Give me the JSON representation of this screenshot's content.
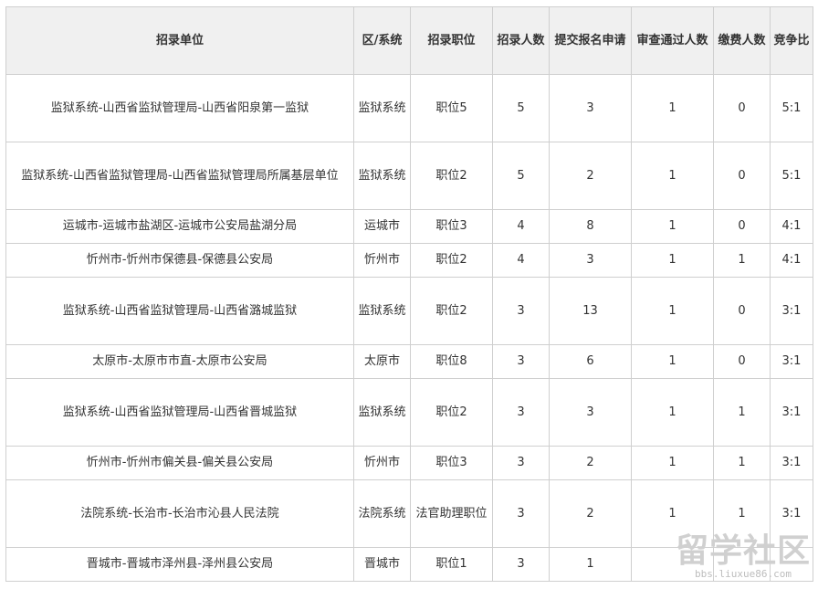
{
  "headers": [
    "招录单位",
    "区/系统",
    "招录职位",
    "招录人数",
    "提交报名申请",
    "审查通过人数",
    "缴费人数",
    "竞争比"
  ],
  "rows": [
    {
      "unit": "监狱系统-山西省监狱管理局-山西省阳泉第一监狱",
      "region": "监狱系统",
      "position": "职位5",
      "quota": "5",
      "submitted": "3",
      "approved": "1",
      "paid": "0",
      "ratio": "5:1"
    },
    {
      "unit": "监狱系统-山西省监狱管理局-山西省监狱管理局所属基层单位",
      "region": "监狱系统",
      "position": "职位2",
      "quota": "5",
      "submitted": "2",
      "approved": "1",
      "paid": "0",
      "ratio": "5:1"
    },
    {
      "unit": "运城市-运城市盐湖区-运城市公安局盐湖分局",
      "region": "运城市",
      "position": "职位3",
      "quota": "4",
      "submitted": "8",
      "approved": "1",
      "paid": "0",
      "ratio": "4:1"
    },
    {
      "unit": "忻州市-忻州市保德县-保德县公安局",
      "region": "忻州市",
      "position": "职位2",
      "quota": "4",
      "submitted": "3",
      "approved": "1",
      "paid": "1",
      "ratio": "4:1"
    },
    {
      "unit": "监狱系统-山西省监狱管理局-山西省潞城监狱",
      "region": "监狱系统",
      "position": "职位2",
      "quota": "3",
      "submitted": "13",
      "approved": "1",
      "paid": "0",
      "ratio": "3:1"
    },
    {
      "unit": "太原市-太原市市直-太原市公安局",
      "region": "太原市",
      "position": "职位8",
      "quota": "3",
      "submitted": "6",
      "approved": "1",
      "paid": "0",
      "ratio": "3:1"
    },
    {
      "unit": "监狱系统-山西省监狱管理局-山西省晋城监狱",
      "region": "监狱系统",
      "position": "职位2",
      "quota": "3",
      "submitted": "3",
      "approved": "1",
      "paid": "1",
      "ratio": "3:1"
    },
    {
      "unit": "忻州市-忻州市偏关县-偏关县公安局",
      "region": "忻州市",
      "position": "职位3",
      "quota": "3",
      "submitted": "2",
      "approved": "1",
      "paid": "1",
      "ratio": "3:1"
    },
    {
      "unit": "法院系统-长治市-长治市沁县人民法院",
      "region": "法院系统",
      "position": "法官助理职位",
      "quota": "3",
      "submitted": "2",
      "approved": "1",
      "paid": "1",
      "ratio": "3:1"
    },
    {
      "unit": "晋城市-晋城市泽州县-泽州县公安局",
      "region": "晋城市",
      "position": "职位1",
      "quota": "3",
      "submitted": "1",
      "approved": "",
      "paid": "",
      "ratio": ""
    }
  ],
  "watermark": {
    "logo": "留学社区",
    "url": "bbs.liuxue86.com"
  }
}
